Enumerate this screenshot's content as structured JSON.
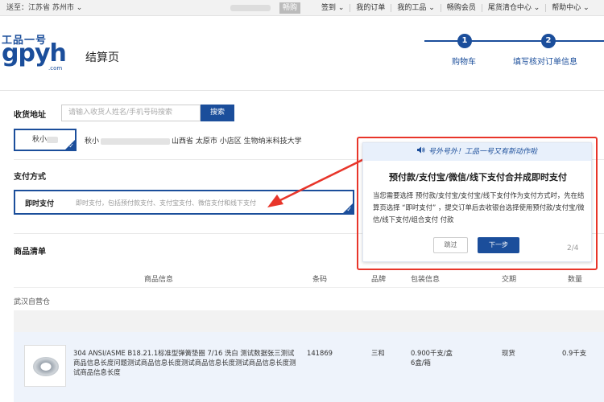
{
  "topbar": {
    "location": "送至：江苏省 苏州市 ⌄",
    "greeting": "畅购",
    "links": [
      "签到 ⌄",
      "我的订单",
      "我的工品 ⌄",
      "畅购会员",
      "尾货清仓中心 ⌄",
      "帮助中心 ⌄"
    ]
  },
  "header": {
    "logo_top": "工品一号",
    "logo_main": "gpyh",
    "logo_com": ".com",
    "page_title": "结算页",
    "steps": [
      {
        "num": "1",
        "label": "购物车"
      },
      {
        "num": "2",
        "label": "填写核对订单信息"
      }
    ]
  },
  "address": {
    "section_title": "收货地址",
    "search_placeholder": "请输入收货人姓名/手机号码搜索",
    "search_button": "搜索",
    "card_name": "秋小",
    "detail_prefix": "秋小",
    "detail_suffix": "山西省 太原市 小店区 生物纳米科技大学"
  },
  "payment": {
    "section_title": "支付方式",
    "selected": "即时支付",
    "description": "即时支付，包括预付款支付、支付宝支付、微信支付和线下支付"
  },
  "popup": {
    "header": "号外号外！工品一号又有新动作啦",
    "title": "预付款/支付宝/微信/线下支付合并成即时支付",
    "body": "当您需要选择 预付款/支付宝/支付宝/线下支付作为支付方式时，先在结算页选择 “即时支付” ，提交订单后去收银台选择使用预付款/支付宝/微信/线下支付/组合支付 付款",
    "skip": "跳过",
    "next": "下一步",
    "page": "2/4"
  },
  "products": {
    "section_title": "商品清单",
    "columns": [
      "商品信息",
      "条码",
      "品牌",
      "包装信息",
      "交期",
      "数量"
    ],
    "warehouse": "武汉自营仓",
    "rows": [
      {
        "name": "304 ANSI/ASME B18.21.1标准型弹簧垫圈 7/16 洗白 测试数据张三测试商品信息长度问题测试商品信息长度测试商品信息长度测试商品信息长度测试商品信息长度",
        "barcode": "141869",
        "brand": "三和",
        "package": "0.900千支/盒",
        "package2": "6盒/箱",
        "delivery": "现货",
        "quantity": "0.9千支"
      }
    ]
  },
  "colors": {
    "accent": "#1b4e9b",
    "highlight": "#e8352a"
  }
}
